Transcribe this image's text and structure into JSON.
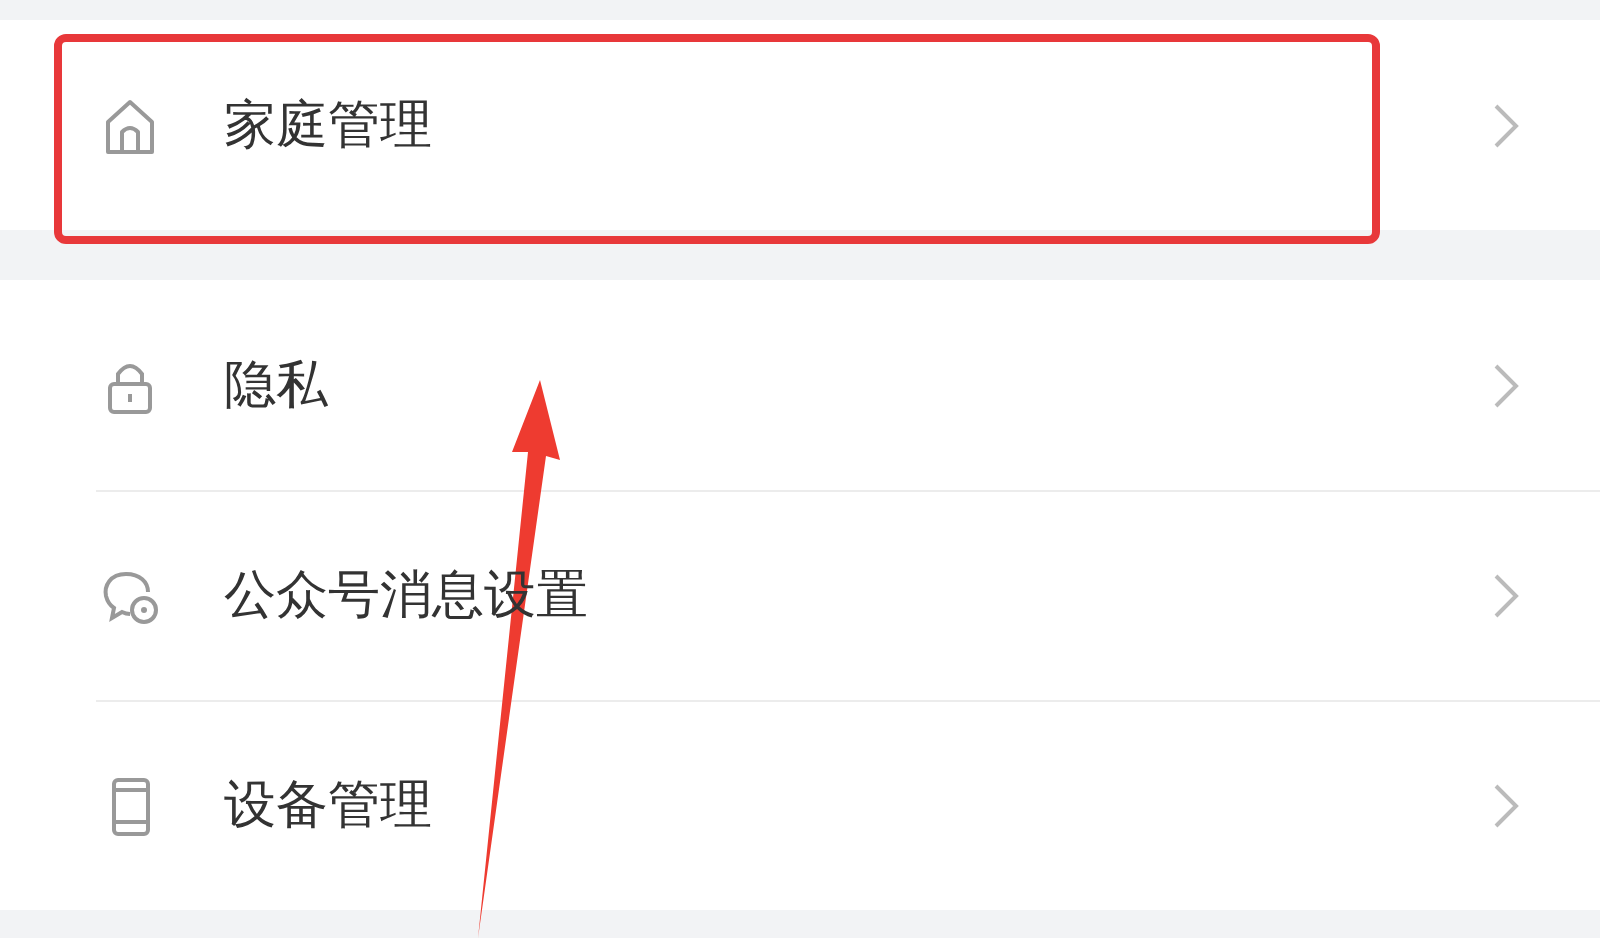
{
  "groups": [
    {
      "items": [
        {
          "label": "家庭管理",
          "highlighted": true
        }
      ]
    },
    {
      "items": [
        {
          "label": "隐私",
          "highlighted": false
        },
        {
          "label": "公众号消息设置",
          "highlighted": false
        },
        {
          "label": "设备管理",
          "highlighted": false
        }
      ]
    }
  ]
}
